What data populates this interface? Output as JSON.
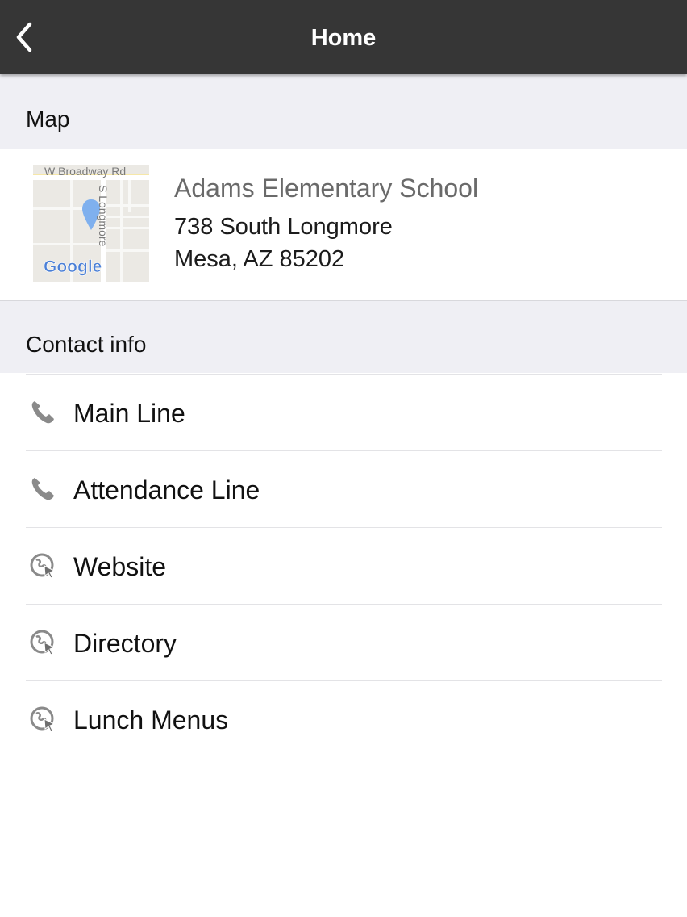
{
  "navbar": {
    "title": "Home",
    "back_icon": "chevron-left-icon"
  },
  "map_section": {
    "header": "Map",
    "thumbnail": {
      "street_top": "W Broadway Rd",
      "street_side": "S Longmore",
      "google_logo": "Google",
      "pin_icon": "map-pin-icon"
    },
    "school_name": "Adams Elementary School",
    "address_line1": "738 South Longmore",
    "address_line2": "Mesa, AZ 85202"
  },
  "contact_section": {
    "header": "Contact info",
    "items": [
      {
        "label": "Main Line",
        "icon": "phone-icon"
      },
      {
        "label": "Attendance Line",
        "icon": "phone-icon"
      },
      {
        "label": "Website",
        "icon": "globe-cursor-icon"
      },
      {
        "label": "Directory",
        "icon": "globe-cursor-icon"
      },
      {
        "label": "Lunch Menus",
        "icon": "globe-cursor-icon"
      }
    ]
  },
  "colors": {
    "navbar_bg": "#363636",
    "section_header_bg": "#efeff4",
    "map_pin": "#7fb0ee",
    "icon_gray": "#8a8a8a"
  }
}
